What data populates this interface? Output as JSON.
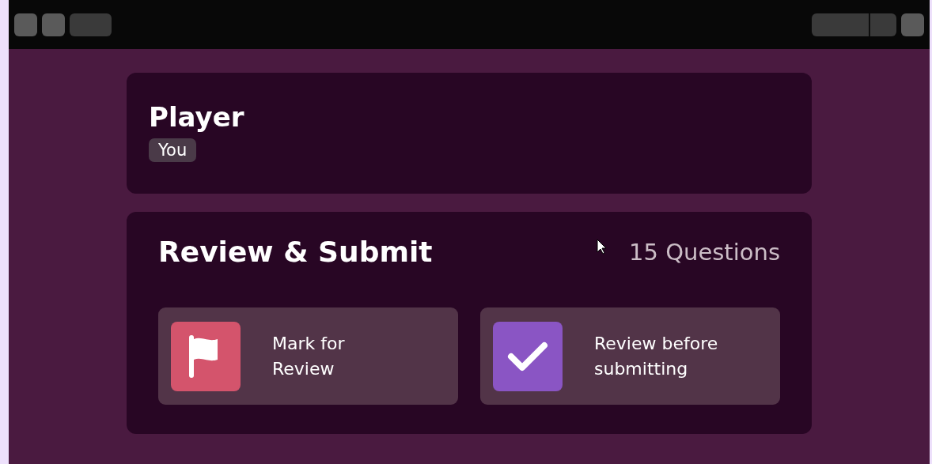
{
  "player": {
    "title": "Player",
    "badge": "You"
  },
  "review": {
    "title": "Review & Submit",
    "count": "15 Questions",
    "options": [
      {
        "kind": "flag",
        "color": "#d4546c",
        "label": "Mark for Review"
      },
      {
        "kind": "check",
        "color": "#8a55c4",
        "label": "Review before submitting"
      }
    ]
  }
}
